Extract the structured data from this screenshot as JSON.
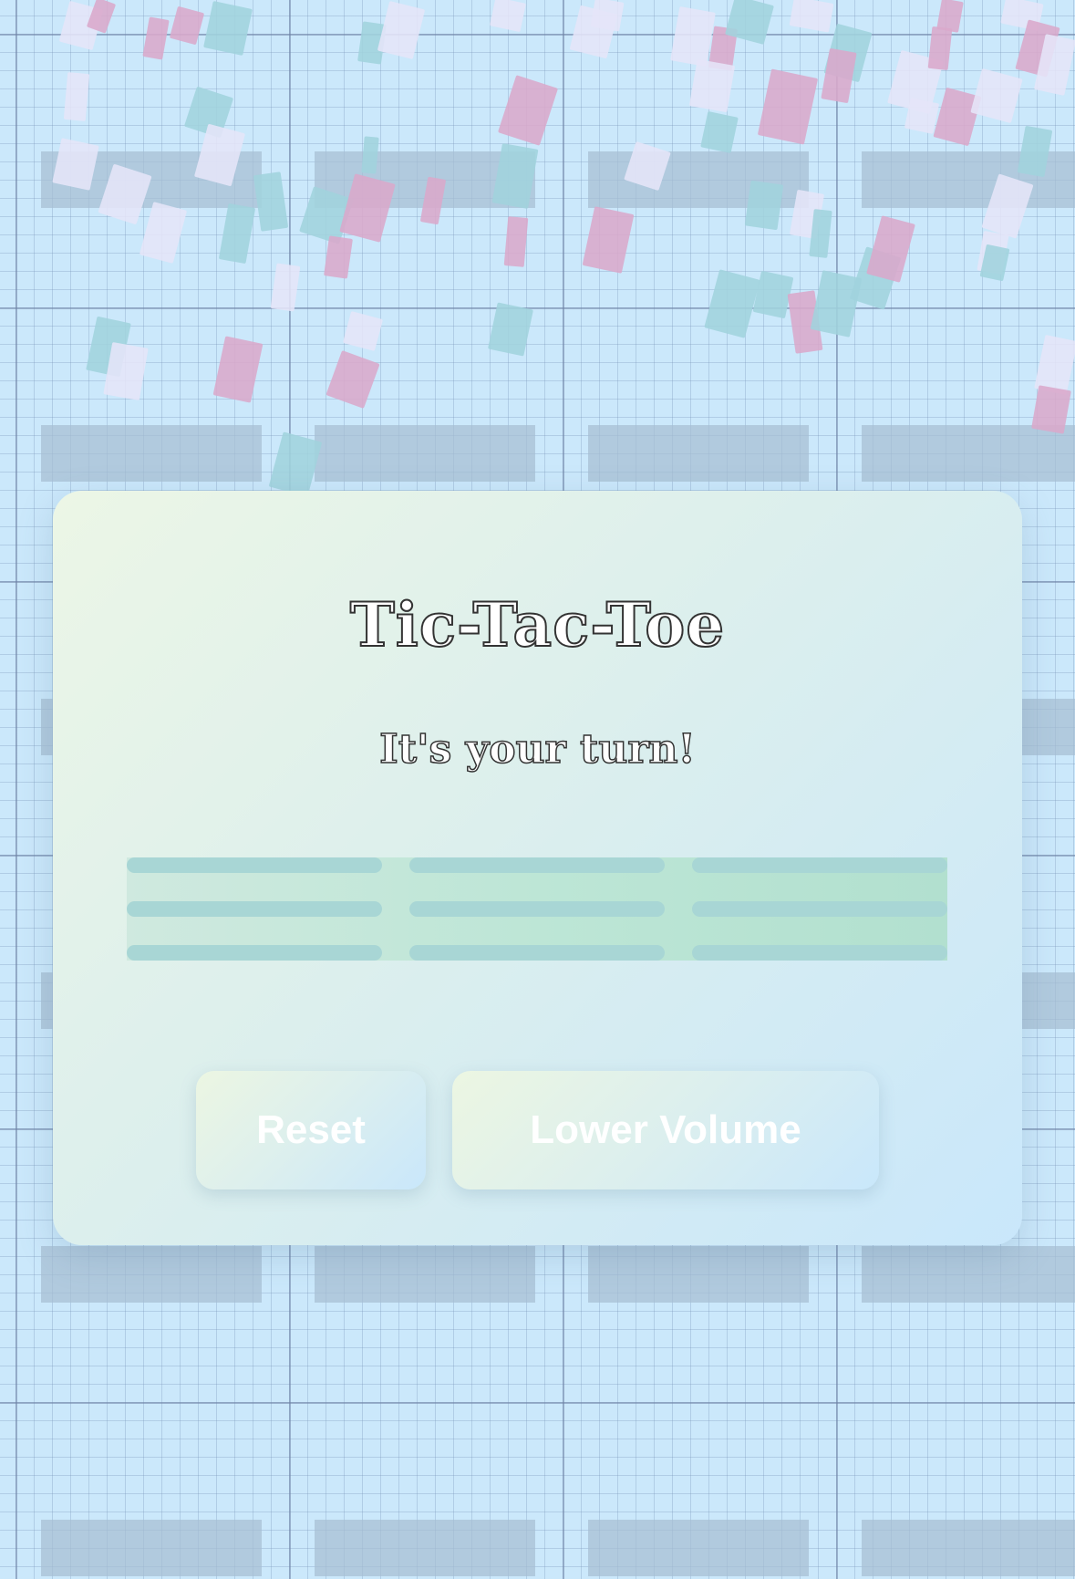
{
  "game": {
    "title": "Tic-Tac-Toe",
    "status": "It's your turn!",
    "board": {
      "rows": 3,
      "cols": 3,
      "cells": [
        "",
        "",
        "",
        "",
        "",
        "",
        "",
        "",
        ""
      ]
    }
  },
  "buttons": {
    "reset_label": "Reset",
    "volume_label": "Lower Volume"
  },
  "colors": {
    "background": "#cbe8fb",
    "card_start": "#ecf6e6",
    "card_end": "#c9e7fb",
    "board": "#bde6d6",
    "cell": "#a8d6d5",
    "confetti_pink": "#d9a9cb",
    "confetti_teal": "#a0d3dd",
    "confetti_lavender": "#e5e5f8"
  }
}
